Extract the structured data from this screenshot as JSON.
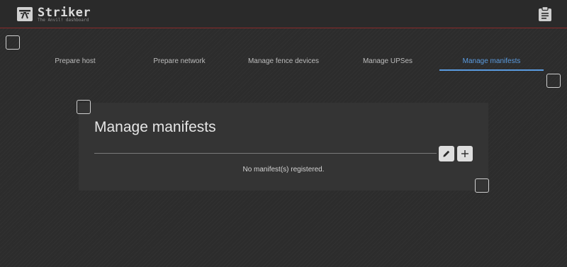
{
  "header": {
    "app_name": "Striker",
    "tagline": "The Anvil! dashboard",
    "logo_icon": "anvil-logo-icon",
    "clipboard_icon": "clipboard-icon"
  },
  "tabs": [
    {
      "label": "Prepare host",
      "active": false
    },
    {
      "label": "Prepare network",
      "active": false
    },
    {
      "label": "Manage fence devices",
      "active": false
    },
    {
      "label": "Manage UPSes",
      "active": false
    },
    {
      "label": "Manage manifests",
      "active": true
    }
  ],
  "panel": {
    "title": "Manage manifests",
    "edit_icon": "pencil-icon",
    "add_icon": "plus-icon",
    "empty_message": "No manifest(s) registered."
  },
  "colors": {
    "accent": "#5a9be0",
    "header_border": "#8a2a2a",
    "panel_bg": "#343434"
  }
}
